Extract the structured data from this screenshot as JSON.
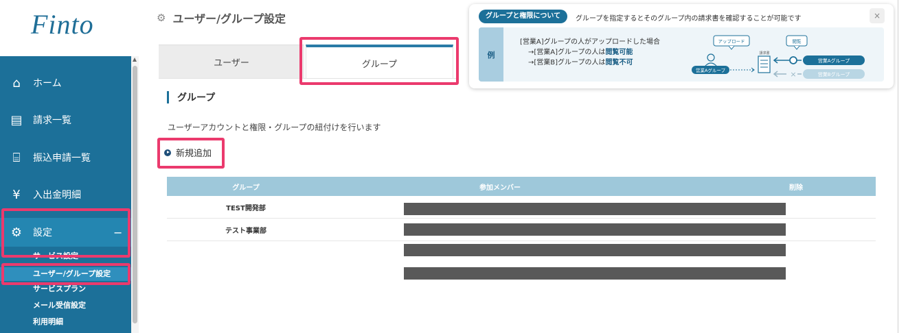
{
  "app": {
    "logo_text": "Finto"
  },
  "sidebar": {
    "items": [
      {
        "icon": "home-icon",
        "glyph": "⌂",
        "label": "ホーム"
      },
      {
        "icon": "invoice-list-icon",
        "glyph": "▤",
        "label": "請求一覧"
      },
      {
        "icon": "bank-icon",
        "glyph": "⌸",
        "label": "振込申請一覧"
      },
      {
        "icon": "yen-icon",
        "glyph": "¥",
        "label": "入出金明細"
      },
      {
        "icon": "gear-icon",
        "glyph": "⚙",
        "label": "設定",
        "toggle": "−"
      }
    ],
    "sub_items": [
      {
        "label": "サービス設定"
      },
      {
        "label": "ユーザー/グループ設定"
      },
      {
        "label": "サービスプラン"
      },
      {
        "label": "メール受信設定"
      },
      {
        "label": "利用明細"
      }
    ]
  },
  "header": {
    "title": "ユーザー/グループ設定"
  },
  "tabs": [
    {
      "label": "ユーザー"
    },
    {
      "label": "グループ"
    }
  ],
  "section": {
    "title": "グループ",
    "description": "ユーザーアカウントと権限・グループの紐付けを行います",
    "add_label": "新規追加"
  },
  "table": {
    "headers": [
      "グループ",
      "参加メンバー",
      "削除"
    ],
    "rows": [
      {
        "group": "TEST開発部"
      },
      {
        "group": "テスト事業部"
      }
    ]
  },
  "popup": {
    "pill": "グループと権限について",
    "description": "グループを指定するとそのグループ内の請求書を確認することが可能です",
    "close": "×",
    "example_label": "例",
    "example_line1": "[営業A]グループの人がアップロードした場合",
    "example_line2_prefix": "→[営業A]グループの人は",
    "example_line2_strong": "閲覧可能",
    "example_line3_prefix": "→[営業B]グループの人は",
    "example_line3_strong": "閲覧不可",
    "diagram": {
      "upload": "アップロード",
      "view": "閲覧",
      "invoice": "請求書",
      "group_a": "営業Aグループ",
      "group_b": "営業Bグループ"
    }
  },
  "colors": {
    "brand": "#1c7099",
    "highlight": "#eb3a6d",
    "table_header": "#9ec8da"
  }
}
